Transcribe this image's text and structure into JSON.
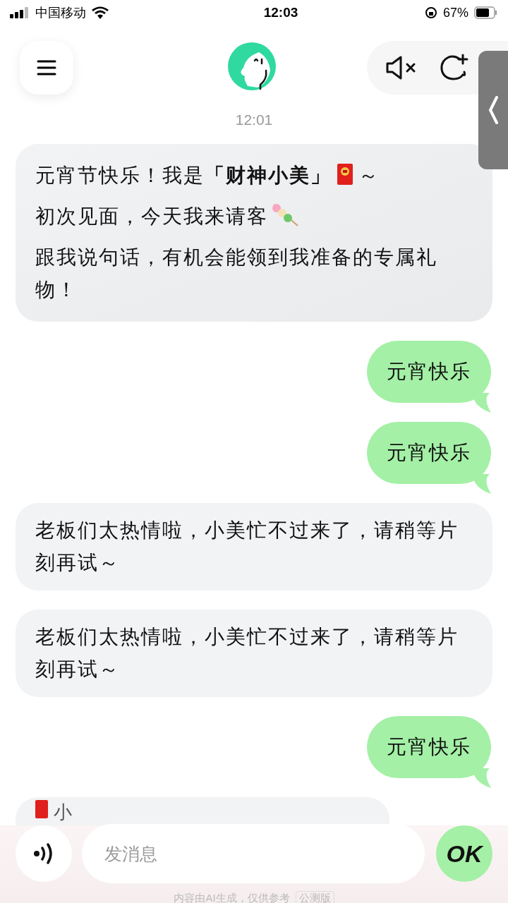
{
  "status_bar": {
    "carrier": "中国移动",
    "time": "12:03",
    "battery": "67%"
  },
  "header": {
    "timestamp": "12:01"
  },
  "messages": [
    {
      "kind": "intro",
      "lines": [
        [
          {
            "kind": "text",
            "text": "元宵节快乐！我是**「财神小美」**"
          },
          {
            "kind": "envelope"
          },
          {
            "kind": "text",
            "text": "～"
          }
        ],
        [
          {
            "kind": "text",
            "text": "初次见面，今天我来请客"
          },
          {
            "kind": "dango"
          }
        ],
        [
          {
            "kind": "text",
            "text": "跟我说句话，有机会能领到我准备的专属礼物！"
          }
        ]
      ]
    },
    {
      "kind": "user",
      "text": "元宵快乐"
    },
    {
      "kind": "user",
      "text": "元宵快乐"
    },
    {
      "kind": "bot",
      "text": "老板们太热情啦，小美忙不过来了，请稍等片刻再试～"
    },
    {
      "kind": "bot",
      "text": "老板们太热情啦，小美忙不过来了，请稍等片刻再试～"
    },
    {
      "kind": "user",
      "text": "元宵快乐"
    },
    {
      "kind": "partial",
      "text": "小"
    }
  ],
  "composer": {
    "placeholder": "发消息",
    "send_label": "OK"
  },
  "footer": {
    "disclaimer": "内容由AI生成，仅供参考",
    "badge": "公测版"
  }
}
